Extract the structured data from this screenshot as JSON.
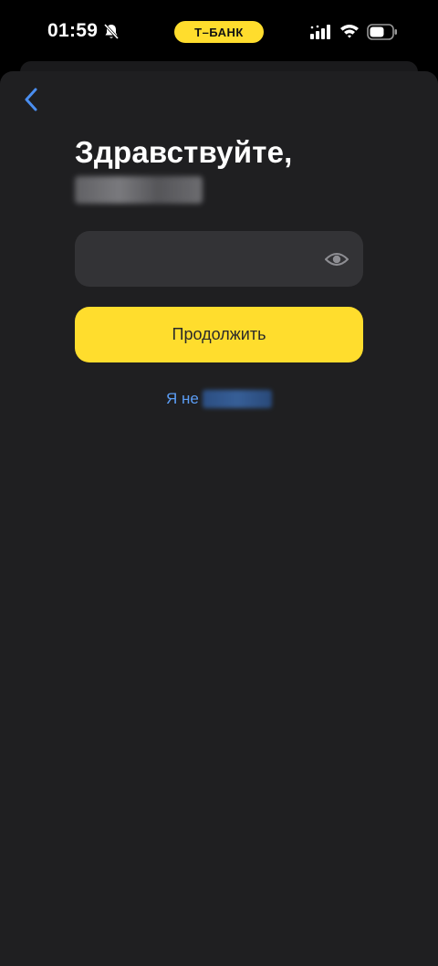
{
  "status_bar": {
    "time": "01:59",
    "brand_pill": "Т–БАНК",
    "icons": [
      "bell-slash-icon",
      "signal-icon",
      "wifi-icon",
      "battery-icon"
    ]
  },
  "login": {
    "greeting": "Здравствуйте,",
    "password_value": "",
    "continue_label": "Продолжить",
    "not_me_prefix": "Я не"
  },
  "colors": {
    "background": "#1f1f21",
    "accent_yellow": "#ffdd2d",
    "link_blue": "#5b9df5",
    "field_bg": "#333336"
  }
}
